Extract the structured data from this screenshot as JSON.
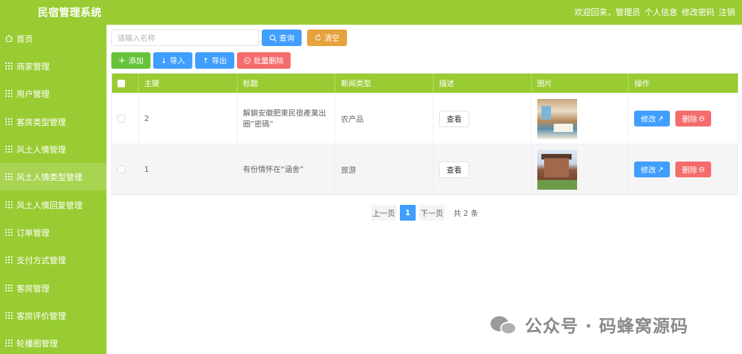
{
  "header": {
    "title": "民宿管理系统",
    "welcome": "欢迎回来，管理员",
    "profile": "个人信息",
    "change_password": "修改密码",
    "logout": "注销"
  },
  "sidebar": {
    "items": [
      {
        "label": "首页",
        "icon": "home-icon"
      },
      {
        "label": "商家管理",
        "icon": "grid-icon"
      },
      {
        "label": "用户管理",
        "icon": "grid-icon"
      },
      {
        "label": "客房类型管理",
        "icon": "grid-icon"
      },
      {
        "label": "风土人情管理",
        "icon": "grid-icon"
      },
      {
        "label": "风土人情类型管理",
        "icon": "grid-icon",
        "active": true
      },
      {
        "label": "风土人情回复管理",
        "icon": "grid-icon"
      },
      {
        "label": "订单管理",
        "icon": "grid-icon"
      },
      {
        "label": "支付方式管理",
        "icon": "grid-icon"
      },
      {
        "label": "客房管理",
        "icon": "grid-icon"
      },
      {
        "label": "客房评价管理",
        "icon": "grid-icon"
      },
      {
        "label": "轮播图管理",
        "icon": "grid-icon"
      }
    ]
  },
  "search": {
    "placeholder": "请输入名称",
    "value": "",
    "search_label": "查询",
    "clear_label": "清空"
  },
  "toolbar": {
    "add_label": "添加",
    "import_label": "导入",
    "export_label": "导出",
    "batch_delete_label": "批量删除"
  },
  "table": {
    "columns": [
      "主键",
      "标题",
      "新闻类型",
      "描述",
      "图片",
      "操作"
    ],
    "rows": [
      {
        "id": "2",
        "title": "解鎖安徽肥東民宿產業出圈“密碼”",
        "type": "农产品",
        "view_label": "查看",
        "image": "room-interior-photo",
        "edit_label": "修改",
        "delete_label": "删除"
      },
      {
        "id": "1",
        "title": "有份情怀在“涵舍”",
        "type": "旅游",
        "view_label": "查看",
        "image": "guesthouse-exterior-photo",
        "edit_label": "修改",
        "delete_label": "删除"
      }
    ]
  },
  "pagination": {
    "prev_label": "上一页",
    "current_page": "1",
    "next_label": "下一页",
    "total_label": "共 2 条"
  },
  "watermark": {
    "text": "公众号 · 码蜂窝源码"
  },
  "colors": {
    "brand_green": "#99cc33",
    "primary_blue": "#409eff",
    "warning_orange": "#e6a23c",
    "success_green": "#67c23a",
    "danger_red": "#f56c6c"
  }
}
